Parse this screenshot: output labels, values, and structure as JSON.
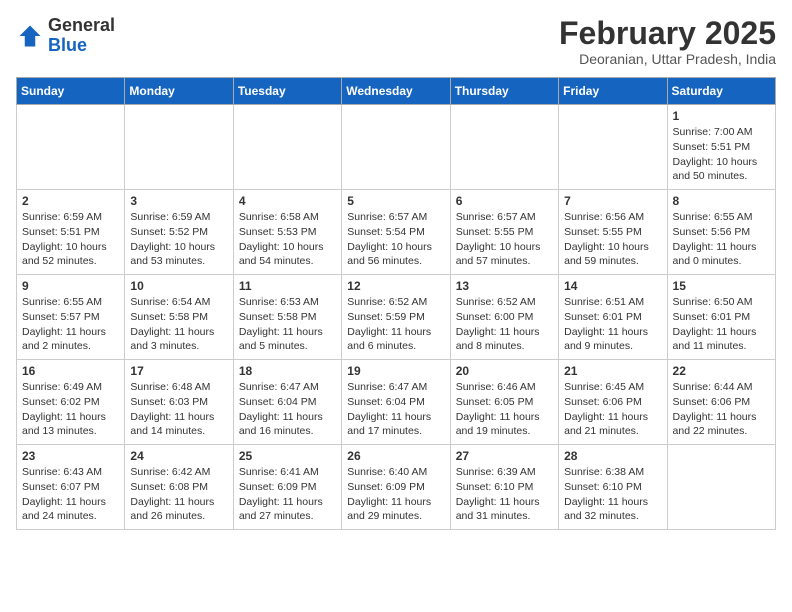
{
  "header": {
    "logo_general": "General",
    "logo_blue": "Blue",
    "month_title": "February 2025",
    "location": "Deoranian, Uttar Pradesh, India"
  },
  "weekdays": [
    "Sunday",
    "Monday",
    "Tuesday",
    "Wednesday",
    "Thursday",
    "Friday",
    "Saturday"
  ],
  "weeks": [
    [
      {
        "day": "",
        "info": ""
      },
      {
        "day": "",
        "info": ""
      },
      {
        "day": "",
        "info": ""
      },
      {
        "day": "",
        "info": ""
      },
      {
        "day": "",
        "info": ""
      },
      {
        "day": "",
        "info": ""
      },
      {
        "day": "1",
        "info": "Sunrise: 7:00 AM\nSunset: 5:51 PM\nDaylight: 10 hours\nand 50 minutes."
      }
    ],
    [
      {
        "day": "2",
        "info": "Sunrise: 6:59 AM\nSunset: 5:51 PM\nDaylight: 10 hours\nand 52 minutes."
      },
      {
        "day": "3",
        "info": "Sunrise: 6:59 AM\nSunset: 5:52 PM\nDaylight: 10 hours\nand 53 minutes."
      },
      {
        "day": "4",
        "info": "Sunrise: 6:58 AM\nSunset: 5:53 PM\nDaylight: 10 hours\nand 54 minutes."
      },
      {
        "day": "5",
        "info": "Sunrise: 6:57 AM\nSunset: 5:54 PM\nDaylight: 10 hours\nand 56 minutes."
      },
      {
        "day": "6",
        "info": "Sunrise: 6:57 AM\nSunset: 5:55 PM\nDaylight: 10 hours\nand 57 minutes."
      },
      {
        "day": "7",
        "info": "Sunrise: 6:56 AM\nSunset: 5:55 PM\nDaylight: 10 hours\nand 59 minutes."
      },
      {
        "day": "8",
        "info": "Sunrise: 6:55 AM\nSunset: 5:56 PM\nDaylight: 11 hours\nand 0 minutes."
      }
    ],
    [
      {
        "day": "9",
        "info": "Sunrise: 6:55 AM\nSunset: 5:57 PM\nDaylight: 11 hours\nand 2 minutes."
      },
      {
        "day": "10",
        "info": "Sunrise: 6:54 AM\nSunset: 5:58 PM\nDaylight: 11 hours\nand 3 minutes."
      },
      {
        "day": "11",
        "info": "Sunrise: 6:53 AM\nSunset: 5:58 PM\nDaylight: 11 hours\nand 5 minutes."
      },
      {
        "day": "12",
        "info": "Sunrise: 6:52 AM\nSunset: 5:59 PM\nDaylight: 11 hours\nand 6 minutes."
      },
      {
        "day": "13",
        "info": "Sunrise: 6:52 AM\nSunset: 6:00 PM\nDaylight: 11 hours\nand 8 minutes."
      },
      {
        "day": "14",
        "info": "Sunrise: 6:51 AM\nSunset: 6:01 PM\nDaylight: 11 hours\nand 9 minutes."
      },
      {
        "day": "15",
        "info": "Sunrise: 6:50 AM\nSunset: 6:01 PM\nDaylight: 11 hours\nand 11 minutes."
      }
    ],
    [
      {
        "day": "16",
        "info": "Sunrise: 6:49 AM\nSunset: 6:02 PM\nDaylight: 11 hours\nand 13 minutes."
      },
      {
        "day": "17",
        "info": "Sunrise: 6:48 AM\nSunset: 6:03 PM\nDaylight: 11 hours\nand 14 minutes."
      },
      {
        "day": "18",
        "info": "Sunrise: 6:47 AM\nSunset: 6:04 PM\nDaylight: 11 hours\nand 16 minutes."
      },
      {
        "day": "19",
        "info": "Sunrise: 6:47 AM\nSunset: 6:04 PM\nDaylight: 11 hours\nand 17 minutes."
      },
      {
        "day": "20",
        "info": "Sunrise: 6:46 AM\nSunset: 6:05 PM\nDaylight: 11 hours\nand 19 minutes."
      },
      {
        "day": "21",
        "info": "Sunrise: 6:45 AM\nSunset: 6:06 PM\nDaylight: 11 hours\nand 21 minutes."
      },
      {
        "day": "22",
        "info": "Sunrise: 6:44 AM\nSunset: 6:06 PM\nDaylight: 11 hours\nand 22 minutes."
      }
    ],
    [
      {
        "day": "23",
        "info": "Sunrise: 6:43 AM\nSunset: 6:07 PM\nDaylight: 11 hours\nand 24 minutes."
      },
      {
        "day": "24",
        "info": "Sunrise: 6:42 AM\nSunset: 6:08 PM\nDaylight: 11 hours\nand 26 minutes."
      },
      {
        "day": "25",
        "info": "Sunrise: 6:41 AM\nSunset: 6:09 PM\nDaylight: 11 hours\nand 27 minutes."
      },
      {
        "day": "26",
        "info": "Sunrise: 6:40 AM\nSunset: 6:09 PM\nDaylight: 11 hours\nand 29 minutes."
      },
      {
        "day": "27",
        "info": "Sunrise: 6:39 AM\nSunset: 6:10 PM\nDaylight: 11 hours\nand 31 minutes."
      },
      {
        "day": "28",
        "info": "Sunrise: 6:38 AM\nSunset: 6:10 PM\nDaylight: 11 hours\nand 32 minutes."
      },
      {
        "day": "",
        "info": ""
      }
    ]
  ]
}
